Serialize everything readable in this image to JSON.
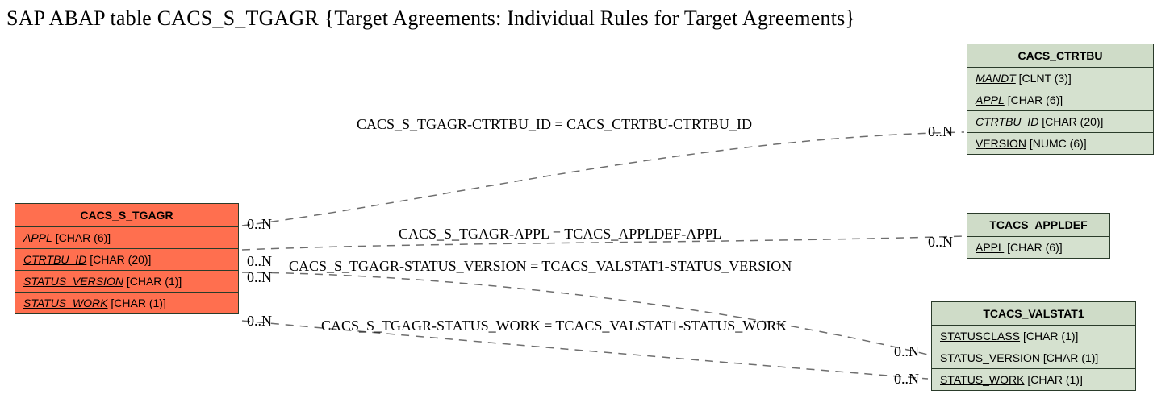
{
  "title": "SAP ABAP table CACS_S_TGAGR {Target Agreements: Individual Rules for Target Agreements}",
  "entities": {
    "main": {
      "name": "CACS_S_TGAGR",
      "rows": [
        {
          "field": "APPL",
          "type": "[CHAR (6)]"
        },
        {
          "field": "CTRTBU_ID",
          "type": "[CHAR (20)]"
        },
        {
          "field": "STATUS_VERSION",
          "type": "[CHAR (1)]"
        },
        {
          "field": "STATUS_WORK",
          "type": "[CHAR (1)]"
        }
      ]
    },
    "e1": {
      "name": "CACS_CTRTBU",
      "rows": [
        {
          "field": "MANDT",
          "type": "[CLNT (3)]"
        },
        {
          "field": "APPL",
          "type": "[CHAR (6)]"
        },
        {
          "field": "CTRTBU_ID",
          "type": "[CHAR (20)]"
        },
        {
          "field": "VERSION",
          "type": "[NUMC (6)]"
        }
      ]
    },
    "e2": {
      "name": "TCACS_APPLDEF",
      "rows": [
        {
          "field": "APPL",
          "type": "[CHAR (6)]"
        }
      ]
    },
    "e3": {
      "name": "TCACS_VALSTAT1",
      "rows": [
        {
          "field": "STATUSCLASS",
          "type": "[CHAR (1)]"
        },
        {
          "field": "STATUS_VERSION",
          "type": "[CHAR (1)]"
        },
        {
          "field": "STATUS_WORK",
          "type": "[CHAR (1)]"
        }
      ]
    }
  },
  "relations": {
    "r1": "CACS_S_TGAGR-CTRTBU_ID = CACS_CTRTBU-CTRTBU_ID",
    "r2": "CACS_S_TGAGR-APPL = TCACS_APPLDEF-APPL",
    "r3": "CACS_S_TGAGR-STATUS_VERSION = TCACS_VALSTAT1-STATUS_VERSION",
    "r4": "CACS_S_TGAGR-STATUS_WORK = TCACS_VALSTAT1-STATUS_WORK"
  },
  "cardinalities": {
    "c_main_r1": "0..N",
    "c_e1_r1": "0..N",
    "c_main_r2": "0..N",
    "c_e2_r2": "0..N",
    "c_main_r3": "0..N",
    "c_e3_r3": "0..N",
    "c_main_r4": "0..N",
    "c_e3_r4": "0..N"
  }
}
